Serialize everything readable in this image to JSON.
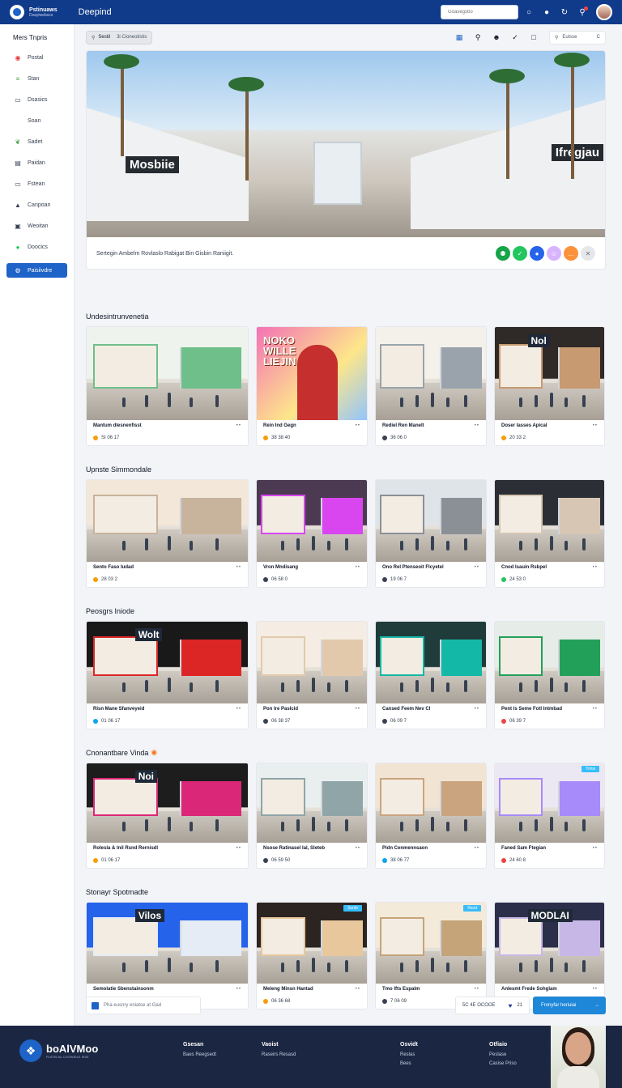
{
  "header": {
    "brand_line1": "Pstinuaws",
    "brand_line2": "Dsayiwebsco",
    "app_title": "Deepind",
    "search_placeholder": "Goasegsbo",
    "icons": [
      "chat-icon",
      "pin-icon",
      "refresh-icon",
      "bell-icon"
    ]
  },
  "sidebar": {
    "title": "Mers Tnpris",
    "items": [
      {
        "label": "Postal",
        "icon": "home-icon",
        "color": "#e53935"
      },
      {
        "label": "Stan",
        "icon": "layers-icon",
        "color": "#43a047"
      },
      {
        "label": "Dsasics",
        "icon": "bag-icon",
        "color": "#374151"
      },
      {
        "label": "Soan",
        "icon": "",
        "color": "#374151"
      },
      {
        "label": "Sadet",
        "icon": "leaf-icon",
        "color": "#43a047"
      },
      {
        "label": "Paidan",
        "icon": "store-icon",
        "color": "#374151"
      },
      {
        "label": "Fstean",
        "icon": "folder-icon",
        "color": "#374151"
      },
      {
        "label": "Canpoan",
        "icon": "car-icon",
        "color": "#374151"
      },
      {
        "label": "Weoitan",
        "icon": "image-icon",
        "color": "#374151"
      },
      {
        "label": "Doocics",
        "icon": "info-icon",
        "color": "#22c55e"
      },
      {
        "label": "Paisiivdre",
        "icon": "settings-icon",
        "color": "#ffffff",
        "active": true
      }
    ]
  },
  "toolbar": {
    "search_label": "Sestil",
    "search_text": "3i Cioneotistis",
    "right_chip": "Eulsse",
    "right_chip_end": "C"
  },
  "hero": {
    "sign_left": "Mosbiie",
    "sign_right": "Ifregjau",
    "caption": "Sertegin Ambelm Rovlaslo Rabigat Bin Gisbin Raniigit.",
    "icon_colors": [
      "#16a34a",
      "#22c55e",
      "#2563eb",
      "#d8b4fe",
      "#fb923c",
      "#e5e7eb"
    ]
  },
  "sections": [
    {
      "title": "Undesintrunvenetia",
      "pin": false,
      "cards": [
        {
          "title": "Mantum dlesnenfisst",
          "date": "SI 06 17",
          "dot": "#f59e0b",
          "scene": "a",
          "sign": "",
          "tag": ""
        },
        {
          "title": "Rein Ind Gegn",
          "date": "38 38 40",
          "dot": "#f59e0b",
          "scene": "poster",
          "sign": "NOKO WILLE LIEJIN",
          "tag": ""
        },
        {
          "title": "Rediel Ren Manelt",
          "date": "36 06 0",
          "dot": "#374151",
          "scene": "c",
          "sign": "",
          "tag": ""
        },
        {
          "title": "Doser Iasses Apical",
          "date": "20 33 2",
          "dot": "#f59e0b",
          "scene": "d",
          "sign": "Nol",
          "tag": ""
        }
      ]
    },
    {
      "title": "Upnste Simmondale",
      "pin": false,
      "cards": [
        {
          "title": "Sento Faso Iudad",
          "date": "28 03 2",
          "dot": "#f59e0b",
          "scene": "e",
          "sign": "",
          "tag": ""
        },
        {
          "title": "Vron Mndisang",
          "date": "06 58 0",
          "dot": "#374151",
          "scene": "f",
          "sign": "",
          "tag": ""
        },
        {
          "title": "Ono Rel Ptenseoit Flcyetel",
          "date": "19 06 7",
          "dot": "#374151",
          "scene": "g",
          "sign": "",
          "tag": ""
        },
        {
          "title": "Cnod Isauin Rsbpel",
          "date": "24 53 0",
          "dot": "#22c55e",
          "scene": "h",
          "sign": "",
          "tag": ""
        }
      ]
    },
    {
      "title": "Peosgrs Iniode",
      "pin": false,
      "cards": [
        {
          "title": "Risn Mane Sfanveyeid",
          "date": "01 06 17",
          "dot": "#0ea5e9",
          "scene": "i",
          "sign": "Wolt",
          "tag": ""
        },
        {
          "title": "Pon Ire Paslcid",
          "date": "06 38 37",
          "dot": "#374151",
          "scene": "j",
          "sign": "",
          "tag": ""
        },
        {
          "title": "Cansed Feem Nev Cl",
          "date": "06 09 7",
          "dot": "#374151",
          "scene": "k",
          "sign": "",
          "tag": ""
        },
        {
          "title": "Pent Is Seme Fotl Intmbad",
          "date": "06 39 7",
          "dot": "#ef4444",
          "scene": "l",
          "sign": "",
          "tag": ""
        }
      ]
    },
    {
      "title": "Cnonantbare Vinda",
      "pin": true,
      "cards": [
        {
          "title": "Rolesla & Inil Rsnd Rernisdl",
          "date": "01 06 17",
          "dot": "#f59e0b",
          "scene": "m",
          "sign": "Noi",
          "tag": ""
        },
        {
          "title": "Nsose Ratinasel Ial, Sleteb",
          "date": "06 59 50",
          "dot": "#374151",
          "scene": "n",
          "sign": "",
          "tag": ""
        },
        {
          "title": "Pidn Cenmennsaon",
          "date": "38 06 77",
          "dot": "#0ea5e9",
          "scene": "o",
          "sign": "",
          "tag": ""
        },
        {
          "title": "Faned Sam Ftegian",
          "date": "24 60 8",
          "dot": "#ef4444",
          "scene": "p",
          "sign": "",
          "tag": "Trmsi"
        }
      ]
    },
    {
      "title": "Stonayr Spotmadte",
      "pin": false,
      "cards": [
        {
          "title": "Semolatie Sbenstainsonm",
          "date": "20 60 17",
          "dot": "#0ea5e9",
          "scene": "q",
          "sign": "Vilos",
          "tag": ""
        },
        {
          "title": "Meleng Minsn Hantad",
          "date": "06 36 68",
          "dot": "#f59e0b",
          "scene": "r",
          "sign": "",
          "tag": "Ssnfo"
        },
        {
          "title": "Tmo Ifts Espalm",
          "date": "7 06 09",
          "dot": "#374151",
          "scene": "s",
          "sign": "",
          "tag": "Rsod"
        },
        {
          "title": "Anlesmt Frede Sohglam",
          "date": "06 06 7",
          "dot": "#374151",
          "scene": "t",
          "sign": "MODLAI",
          "tag": ""
        }
      ]
    }
  ],
  "bottom": {
    "note": "Pha eusnry eniatse at Gad",
    "count_text": "5C 4E OCOOE",
    "likes": "21",
    "primary": "Fronyfar heriuiai"
  },
  "footer": {
    "logo_text": "boAlVMoo",
    "logo_sub": "PLATELNL CGOWIDLE ISSE",
    "columns": [
      {
        "heading": "Gsesan",
        "links": [
          "Baes Reegsedt"
        ]
      },
      {
        "heading": "Vaoist",
        "links": [
          "Raseirs Resasd"
        ]
      },
      {
        "heading": "Osvidt",
        "links": [
          "Reslas",
          "Bees"
        ]
      },
      {
        "heading": "Otfiaio",
        "links": [
          "Peslase",
          "Casise Priso"
        ]
      }
    ]
  }
}
